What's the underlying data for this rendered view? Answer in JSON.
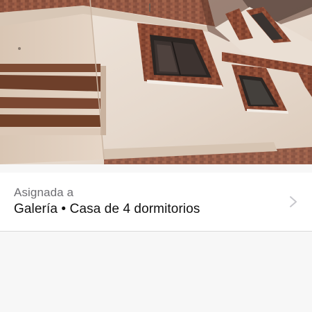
{
  "photo": {
    "icon": "building-facade-photo"
  },
  "assignment": {
    "label": "Asignada a",
    "value": "Galería • Casa de 4 dormitorios",
    "chevron_icon": "chevron-right-icon"
  },
  "colors": {
    "background": "#f7f7f7",
    "row_background": "#ffffff",
    "label_text": "#6e6e73",
    "value_text": "#111111",
    "chevron": "#c7c7cc",
    "wall": "#e7dbcf",
    "brick": "#8a4a33"
  }
}
